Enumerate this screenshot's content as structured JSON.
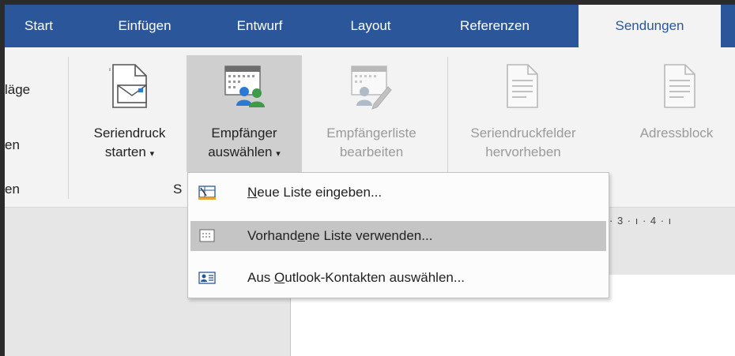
{
  "tabs": [
    {
      "label": "Start",
      "active": false
    },
    {
      "label": "Einfügen",
      "active": false
    },
    {
      "label": "Entwurf",
      "active": false
    },
    {
      "label": "Layout",
      "active": false
    },
    {
      "label": "Referenzen",
      "active": false
    },
    {
      "label": "Sendungen",
      "active": true
    }
  ],
  "ribbon": {
    "left_fragments": [
      "läge",
      "en",
      "en"
    ],
    "group_label_fragment": "S",
    "buttons": {
      "seriendruck_starten": {
        "line1": "Seriendruck",
        "line2": "starten",
        "icon": "document-envelope-icon",
        "enabled": true
      },
      "empfaenger_auswaehlen": {
        "line1": "Empfänger",
        "line2": "auswählen",
        "icon": "recipients-group-icon",
        "enabled": true,
        "pressed": true
      },
      "empfaengerliste_bearbeiten": {
        "line1": "Empfängerliste",
        "line2": "bearbeiten",
        "icon": "edit-recipients-icon",
        "enabled": false
      },
      "seriendruckfelder_hervorheben": {
        "line1": "Seriendruckfelder",
        "line2": "hervorheben",
        "icon": "highlight-fields-icon",
        "enabled": false
      },
      "adressblock": {
        "line1": "Adressblock",
        "icon": "address-block-icon",
        "enabled": false
      }
    }
  },
  "ruler": {
    "text": "· 3 · ı · 4 · ı"
  },
  "menu": {
    "items": [
      {
        "pre": "",
        "underlined": "N",
        "post": "eue Liste eingeben...",
        "icon": "new-list-icon",
        "highlighted": false
      },
      {
        "pre": "Vorhand",
        "underlined": "e",
        "post": "ne Liste verwenden...",
        "icon": "existing-list-icon",
        "highlighted": true
      },
      {
        "pre": "Aus ",
        "underlined": "O",
        "post": "utlook-Kontakten auswählen...",
        "icon": "outlook-contacts-icon",
        "highlighted": false
      }
    ]
  },
  "colors": {
    "accent": "#2b579a",
    "ribbon_bg": "#f3f3f3",
    "menu_highlight": "#c5c5c5"
  }
}
